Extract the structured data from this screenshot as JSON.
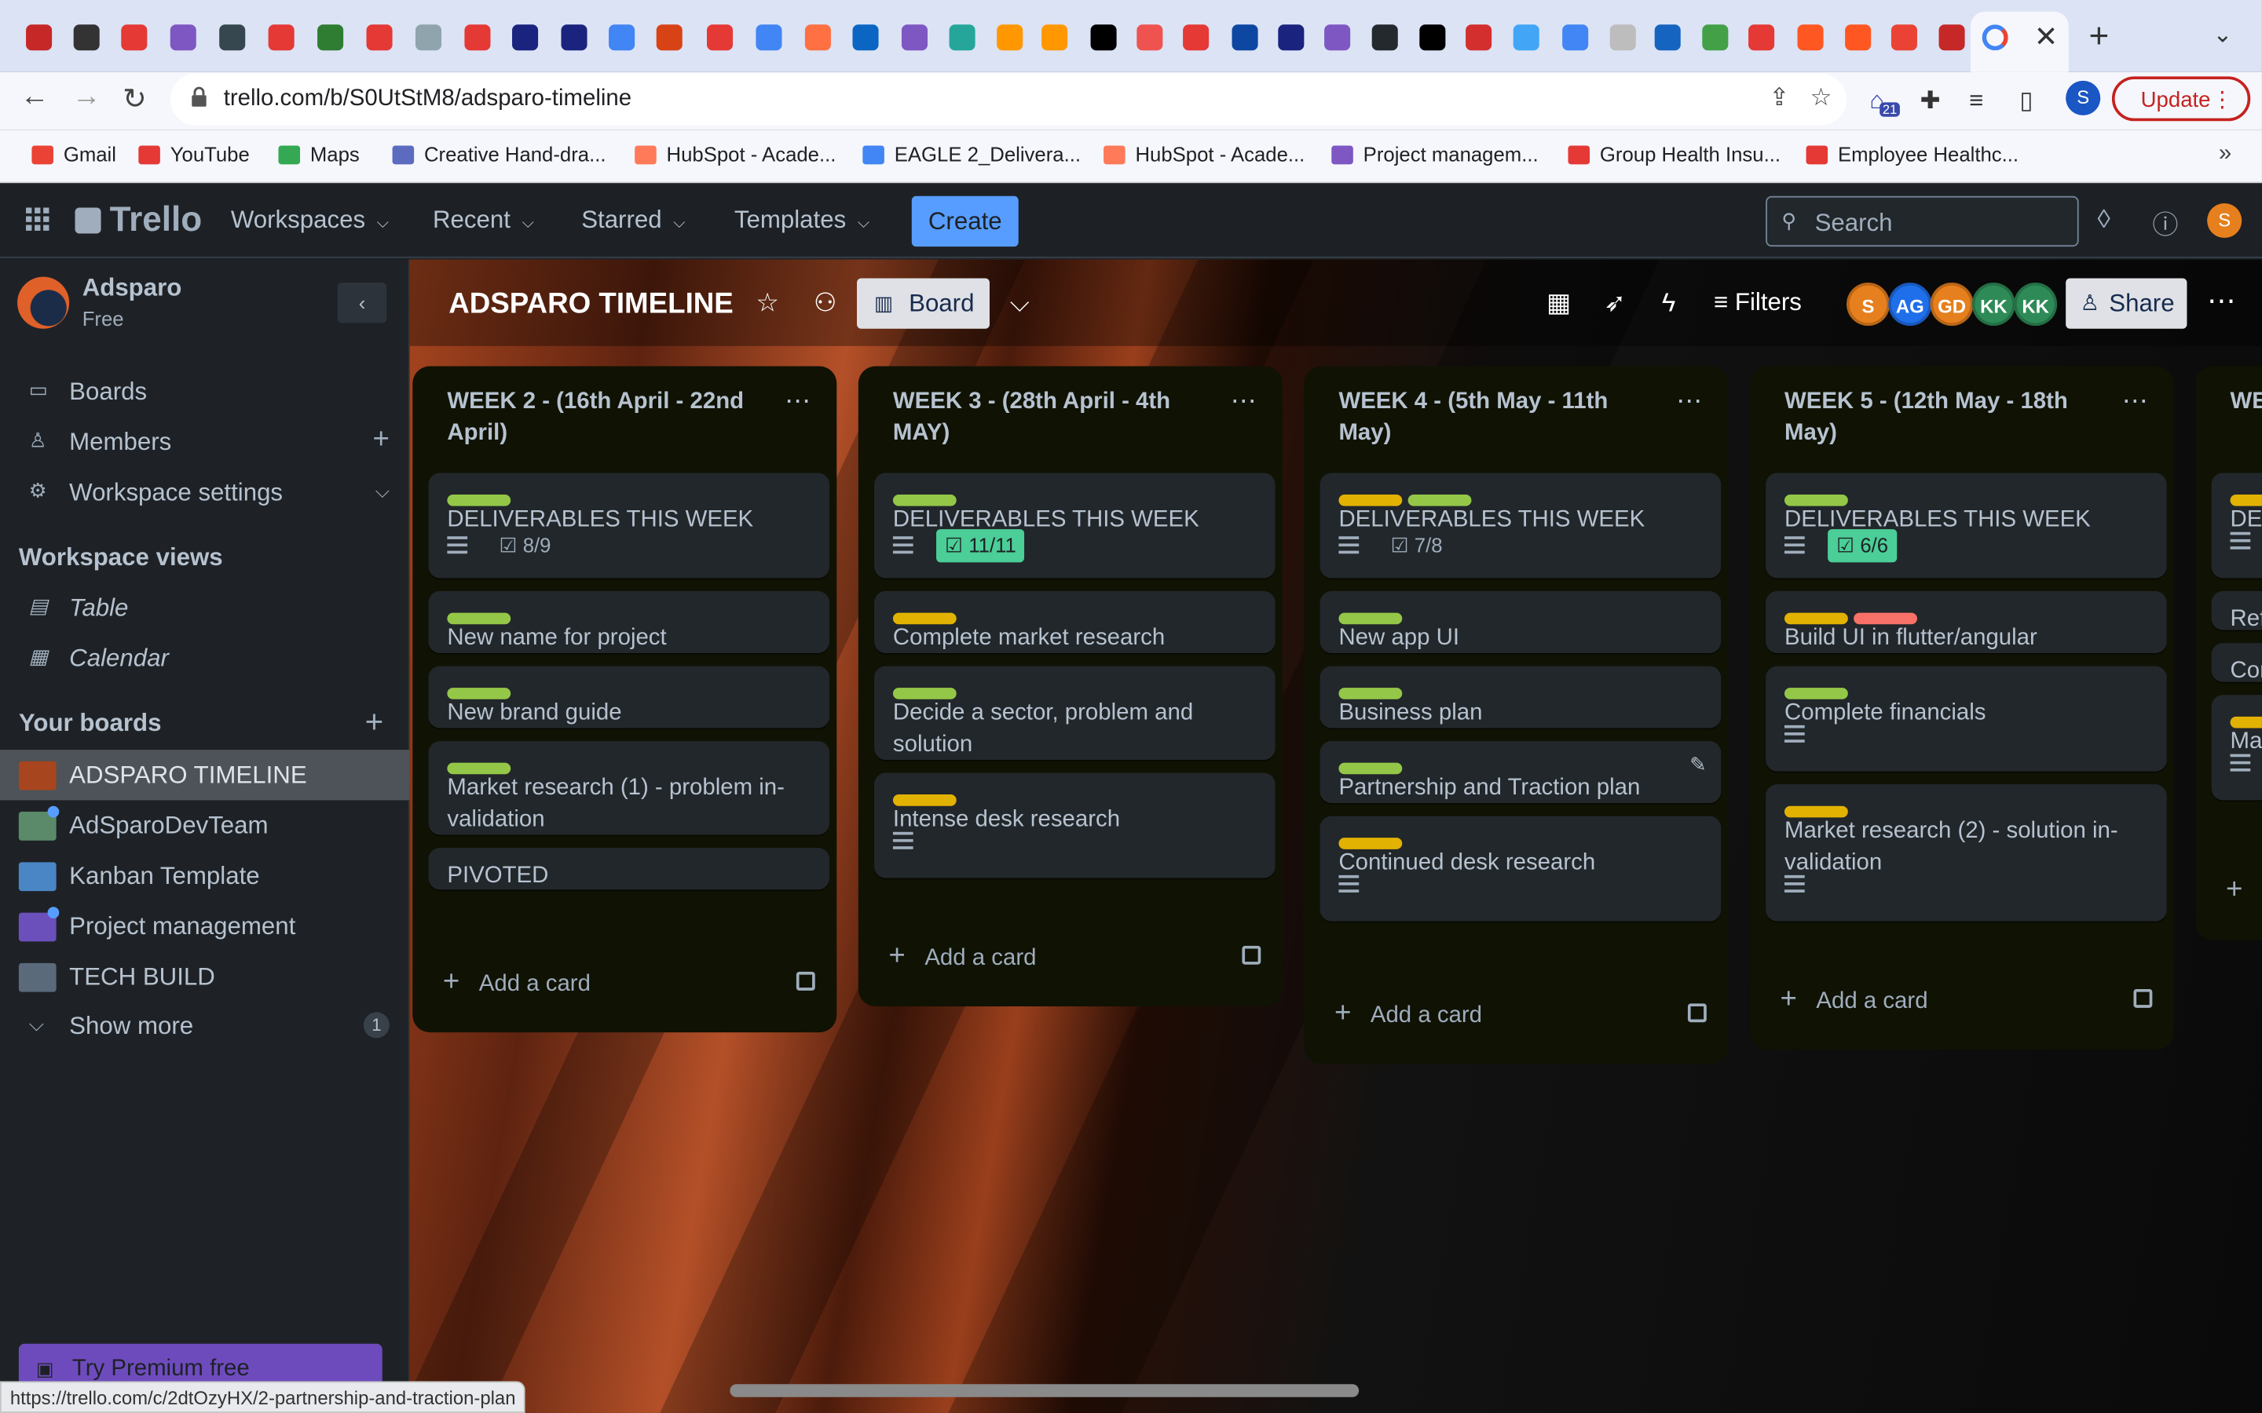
{
  "browser": {
    "tab_colors": [
      "#c62828",
      "#333333",
      "#e53935",
      "#7e57c2",
      "#37474f",
      "#e53935",
      "#2e7d32",
      "#e53935",
      "#90a4ae",
      "#e53935",
      "#1a237e",
      "#1a237e",
      "#4285f4",
      "#d84315",
      "#e53935",
      "#4285f4",
      "#ff7043",
      "#0a66c2",
      "#7e57c2",
      "#26a69a",
      "#ff9800",
      "#ff9800",
      "#000000",
      "#ef5350",
      "#e53935",
      "#0d47a1",
      "#1a237e",
      "#7e57c2",
      "#24292e",
      "#000000",
      "#d32f2f",
      "#42a5f5",
      "#4285f4",
      "#bdbdbd",
      "#1565c0",
      "#43a047",
      "#e53935",
      "#ff5722",
      "#ff5722",
      "#ea4335",
      "#c62828"
    ],
    "active_tab_close": "✕",
    "new_tab": "+",
    "url": "trello.com/b/S0UtStM8/adsparo-timeline",
    "update_label": "Update",
    "profile_initial": "S",
    "extensions_badge": "21",
    "status_url": "https://trello.com/c/2dtOzyHX/2-partnership-and-traction-plan"
  },
  "bookmarks": [
    {
      "label": "Gmail",
      "color": "#ea4335"
    },
    {
      "label": "YouTube",
      "color": "#e53935"
    },
    {
      "label": "Maps",
      "color": "#34a853"
    },
    {
      "label": "Creative Hand-dra...",
      "color": "#5c6bc0"
    },
    {
      "label": "HubSpot - Acade...",
      "color": "#ff7a59"
    },
    {
      "label": "EAGLE 2_Delivera...",
      "color": "#4285f4"
    },
    {
      "label": "HubSpot - Acade...",
      "color": "#ff7a59"
    },
    {
      "label": "Project managem...",
      "color": "#7e57c2"
    },
    {
      "label": "Group Health Insu...",
      "color": "#e53935"
    },
    {
      "label": "Employee Healthc...",
      "color": "#e53935"
    }
  ],
  "trello": {
    "logo": "Trello",
    "menus": [
      "Workspaces",
      "Recent",
      "Starred",
      "Templates"
    ],
    "create_label": "Create",
    "search_placeholder": "Search",
    "user_initial": "S"
  },
  "sidebar": {
    "workspace_name": "Adsparo",
    "workspace_plan": "Free",
    "items": [
      {
        "label": "Boards",
        "icon": "board-icon"
      },
      {
        "label": "Members",
        "icon": "person-icon"
      },
      {
        "label": "Workspace settings",
        "icon": "gear-icon"
      }
    ],
    "views_heading": "Workspace views",
    "views": [
      {
        "label": "Table",
        "icon": "table-icon"
      },
      {
        "label": "Calendar",
        "icon": "calendar-icon"
      }
    ],
    "boards_heading": "Your boards",
    "boards": [
      {
        "label": "ADSPARO TIMELINE",
        "color": "#a7451f",
        "active": true
      },
      {
        "label": "AdSparoDevTeam",
        "color": "#5a8a6a",
        "active": false
      },
      {
        "label": "Kanban Template",
        "color": "#4a86c5",
        "active": false
      },
      {
        "label": "Project management",
        "color": "#6b4fbb",
        "active": false
      },
      {
        "label": "TECH BUILD",
        "color": "#5a6a7a",
        "active": false
      }
    ],
    "show_more": "Show more",
    "show_more_count": "1",
    "premium": "Try Premium free"
  },
  "board": {
    "title": "ADSPARO TIMELINE",
    "view_label": "Board",
    "filters_label": "Filters",
    "share_label": "Share",
    "members": [
      {
        "initials": "S",
        "color": "#e67f1d"
      },
      {
        "initials": "AG",
        "color": "#1f6feb"
      },
      {
        "initials": "GD",
        "color": "#e67f1d"
      },
      {
        "initials": "KK",
        "color": "#2e8b57"
      },
      {
        "initials": "KK",
        "color": "#2e8b57"
      }
    ],
    "add_card_label": "Add a card",
    "lists": [
      {
        "title": "WEEK 2 - (16th April - 22nd April)",
        "cards": [
          {
            "labels": [
              "#94c748"
            ],
            "title": "DELIVERABLES THIS WEEK",
            "desc": true,
            "checklist": "8/9",
            "complete": false
          },
          {
            "labels": [
              "#94c748"
            ],
            "title": "New name for project"
          },
          {
            "labels": [
              "#94c748"
            ],
            "title": "New brand guide"
          },
          {
            "labels": [
              "#94c748"
            ],
            "title": "Market research (1) - problem in-validation"
          },
          {
            "labels": [],
            "title": "PIVOTED"
          }
        ]
      },
      {
        "title": "WEEK 3 - (28th April - 4th MAY)",
        "cards": [
          {
            "labels": [
              "#94c748"
            ],
            "title": "DELIVERABLES THIS WEEK",
            "desc": true,
            "checklist": "11/11",
            "complete": true
          },
          {
            "labels": [
              "#e2b203"
            ],
            "title": "Complete market research"
          },
          {
            "labels": [
              "#94c748"
            ],
            "title": "Decide a sector, problem and solution"
          },
          {
            "labels": [
              "#e2b203"
            ],
            "title": "Intense desk research",
            "desc": true
          }
        ]
      },
      {
        "title": "WEEK 4 - (5th May - 11th May)",
        "cards": [
          {
            "labels": [
              "#e2b203",
              "#94c748"
            ],
            "title": "DELIVERABLES THIS WEEK",
            "desc": true,
            "checklist": "7/8",
            "complete": false
          },
          {
            "labels": [
              "#94c748"
            ],
            "title": "New app UI"
          },
          {
            "labels": [
              "#94c748"
            ],
            "title": "Business plan"
          },
          {
            "labels": [
              "#94c748"
            ],
            "title": "Partnership and Traction plan",
            "hover": true
          },
          {
            "labels": [
              "#e2b203"
            ],
            "title": "Continued desk research",
            "desc": true
          }
        ]
      },
      {
        "title": "WEEK 5 - (12th May - 18th May)",
        "cards": [
          {
            "labels": [
              "#94c748"
            ],
            "title": "DELIVERABLES THIS WEEK",
            "desc": true,
            "checklist": "6/6",
            "complete": true
          },
          {
            "labels": [
              "#e2b203",
              "#f87168"
            ],
            "title": "Build UI in flutter/angular"
          },
          {
            "labels": [
              "#94c748"
            ],
            "title": "Complete financials",
            "desc": true
          },
          {
            "labels": [
              "#e2b203"
            ],
            "title": "Market research (2) - solution in-validation",
            "desc": true
          }
        ]
      },
      {
        "title": "WE Ma",
        "cards": [
          {
            "labels": [
              "#e2b203"
            ],
            "title": "DE",
            "desc": true
          },
          {
            "labels": [],
            "title": "Ref"
          },
          {
            "labels": [],
            "title": "Cor"
          },
          {
            "labels": [
              "#e2b203"
            ],
            "title": "Ma",
            "desc": true
          }
        ]
      }
    ]
  }
}
